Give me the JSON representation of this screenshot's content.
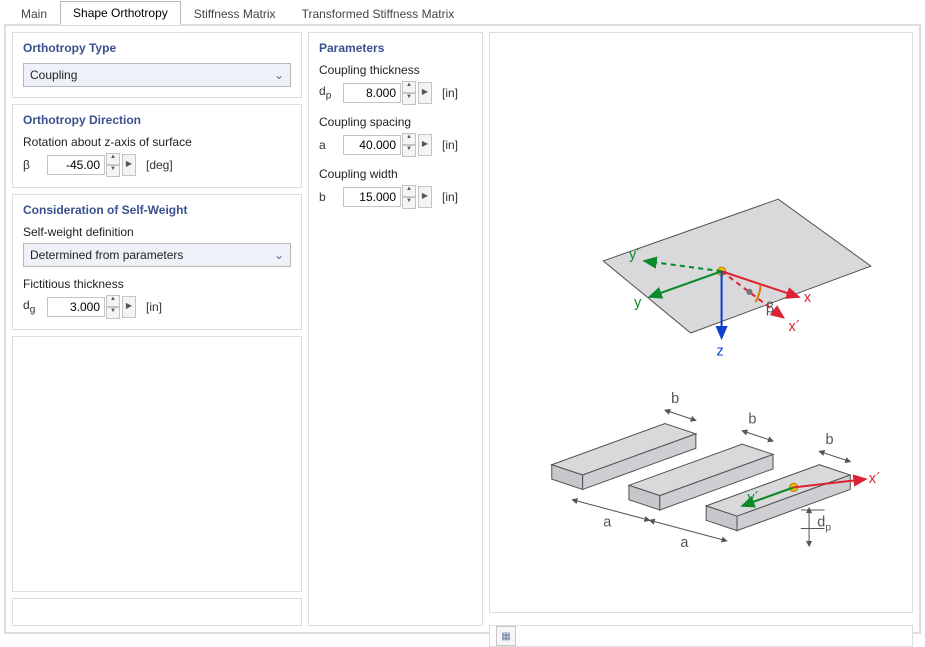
{
  "tabs": {
    "main": "Main",
    "shape": "Shape Orthotropy",
    "stiff": "Stiffness Matrix",
    "tstiff": "Transformed Stiffness Matrix"
  },
  "ortho_type": {
    "title": "Orthotropy Type",
    "value": "Coupling"
  },
  "direction": {
    "title": "Orthotropy Direction",
    "label": "Rotation about z-axis of surface",
    "sym": "β",
    "value": "-45.00",
    "unit": "[deg]"
  },
  "selfweight": {
    "title": "Consideration of Self-Weight",
    "def_label": "Self-weight definition",
    "def_value": "Determined from parameters",
    "fict_label": "Fictitious thickness",
    "fict_sym": "d",
    "fict_sub": "g",
    "fict_value": "3.000",
    "fict_unit": "[in]"
  },
  "params": {
    "title": "Parameters",
    "p1_label": "Coupling thickness",
    "p1_sym": "d",
    "p1_sub": "p",
    "p1_value": "8.000",
    "p1_unit": "[in]",
    "p2_label": "Coupling spacing",
    "p2_sym": "a",
    "p2_value": "40.000",
    "p2_unit": "[in]",
    "p3_label": "Coupling width",
    "p3_sym": "b",
    "p3_value": "15.000",
    "p3_unit": "[in]"
  },
  "diagram": {
    "x": "x",
    "xp": "x´",
    "y": "y",
    "yp": "y´",
    "z": "z",
    "beta": "β",
    "a": "a",
    "b": "b",
    "dp_sym": "d",
    "dp_sub": "p"
  }
}
